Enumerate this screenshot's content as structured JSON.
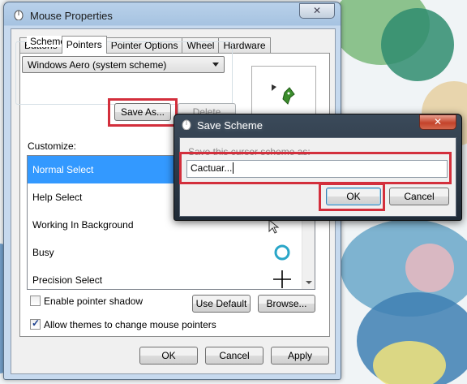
{
  "main_window": {
    "title": "Mouse Properties",
    "close": "✕",
    "tabs": [
      {
        "label": "Buttons"
      },
      {
        "label": "Pointers",
        "active": true
      },
      {
        "label": "Pointer Options"
      },
      {
        "label": "Wheel"
      },
      {
        "label": "Hardware"
      }
    ],
    "scheme_label": "Scheme",
    "scheme_value": "Windows Aero (system scheme)",
    "save_as": "Save As...",
    "delete": "Delete",
    "customize_label": "Customize:",
    "pointers": [
      {
        "label": "Normal Select",
        "selected": true
      },
      {
        "label": "Help Select"
      },
      {
        "label": "Working In Background"
      },
      {
        "label": "Busy"
      },
      {
        "label": "Precision Select"
      }
    ],
    "enable_shadow": {
      "label": "Enable pointer shadow",
      "checked": false
    },
    "allow_themes": {
      "label": "Allow themes to change mouse pointers",
      "checked": true
    },
    "use_default": "Use Default",
    "browse": "Browse...",
    "ok": "OK",
    "cancel": "Cancel",
    "apply": "Apply"
  },
  "save_dialog": {
    "title": "Save Scheme",
    "close": "✕",
    "prompt": "Save this cursor scheme as:",
    "value": "Cactuar...",
    "ok": "OK",
    "cancel": "Cancel"
  },
  "colors": {
    "highlight": "#d32f3c",
    "selection": "#3399ff"
  }
}
